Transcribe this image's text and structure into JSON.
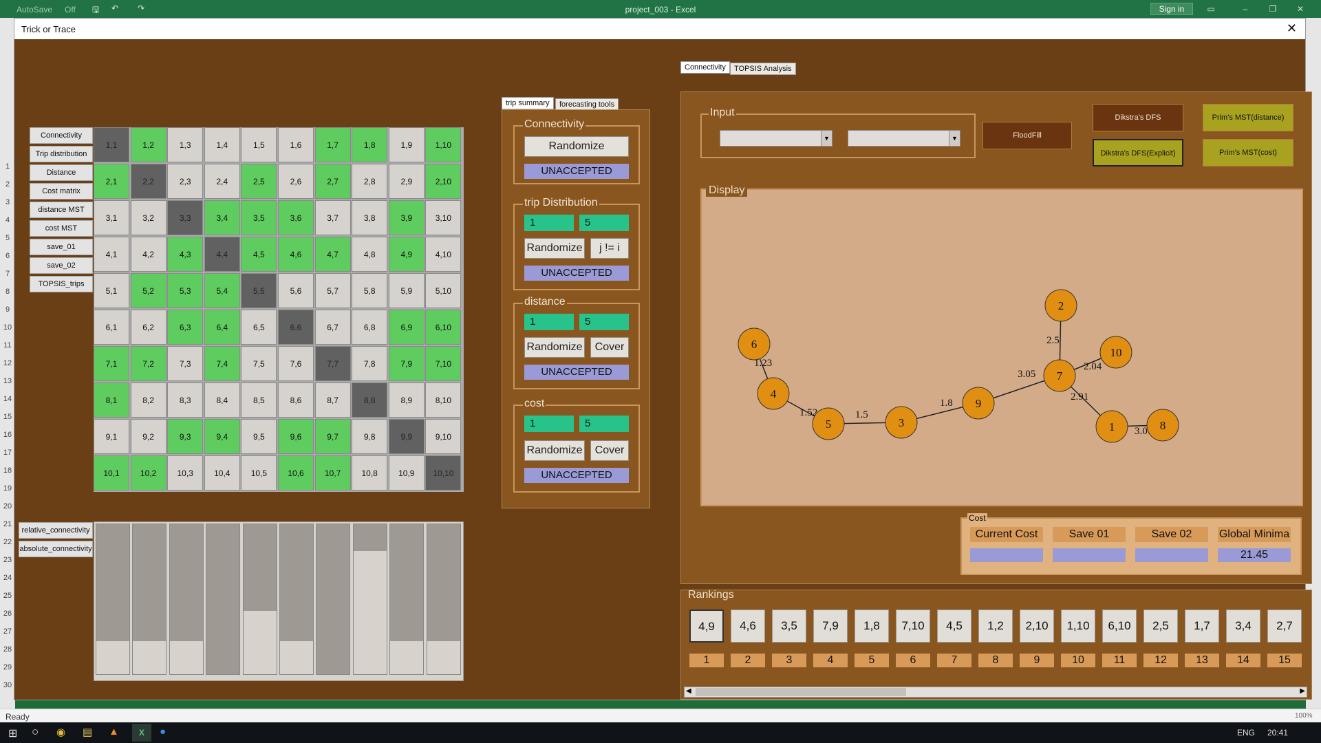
{
  "excel": {
    "autosave": "AutoSave",
    "autosave_state": "Off",
    "title": "project_003 - Excel",
    "sign_in": "Sign in",
    "status": "Ready",
    "zoom": "100%",
    "row_numbers": [
      "1",
      "2",
      "3",
      "4",
      "5",
      "6",
      "7",
      "8",
      "9",
      "10",
      "11",
      "12",
      "13",
      "14",
      "15",
      "16",
      "17",
      "18",
      "19",
      "20",
      "21",
      "22",
      "23",
      "24",
      "25",
      "26",
      "27",
      "28",
      "29",
      "30"
    ]
  },
  "taskbar": {
    "lang": "ENG",
    "time": "20:41"
  },
  "form": {
    "title": "Trick or Trace",
    "close_label": "✕",
    "left_buttons": [
      "Connectivity",
      "Trip distribution",
      "Distance",
      "Cost matrix",
      "distance MST",
      "cost MST",
      "save_01",
      "save_02",
      "TOPSIS_trips"
    ],
    "bar_buttons": [
      "relative_connectivity",
      "absolute_connectivity"
    ],
    "grid": [
      [
        "1,1",
        "1,2",
        "1,3",
        "1,4",
        "1,5",
        "1,6",
        "1,7",
        "1,8",
        "1,9",
        "1,10"
      ],
      [
        "2,1",
        "2,2",
        "2,3",
        "2,4",
        "2,5",
        "2,6",
        "2,7",
        "2,8",
        "2,9",
        "2,10"
      ],
      [
        "3,1",
        "3,2",
        "3,3",
        "3,4",
        "3,5",
        "3,6",
        "3,7",
        "3,8",
        "3,9",
        "3,10"
      ],
      [
        "4,1",
        "4,2",
        "4,3",
        "4,4",
        "4,5",
        "4,6",
        "4,7",
        "4,8",
        "4,9",
        "4,10"
      ],
      [
        "5,1",
        "5,2",
        "5,3",
        "5,4",
        "5,5",
        "5,6",
        "5,7",
        "5,8",
        "5,9",
        "5,10"
      ],
      [
        "6,1",
        "6,2",
        "6,3",
        "6,4",
        "6,5",
        "6,6",
        "6,7",
        "6,8",
        "6,9",
        "6,10"
      ],
      [
        "7,1",
        "7,2",
        "7,3",
        "7,4",
        "7,5",
        "7,6",
        "7,7",
        "7,8",
        "7,9",
        "7,10"
      ],
      [
        "8,1",
        "8,2",
        "8,3",
        "8,4",
        "8,5",
        "8,6",
        "8,7",
        "8,8",
        "8,9",
        "8,10"
      ],
      [
        "9,1",
        "9,2",
        "9,3",
        "9,4",
        "9,5",
        "9,6",
        "9,7",
        "9,8",
        "9,9",
        "9,10"
      ],
      [
        "10,1",
        "10,2",
        "10,3",
        "10,4",
        "10,5",
        "10,6",
        "10,7",
        "10,8",
        "10,9",
        "10,10"
      ]
    ],
    "grid_state": [
      [
        "d",
        "g",
        "n",
        "n",
        "n",
        "n",
        "g",
        "g",
        "n",
        "g"
      ],
      [
        "g",
        "d",
        "n",
        "n",
        "g",
        "n",
        "g",
        "n",
        "n",
        "g"
      ],
      [
        "n",
        "n",
        "d",
        "g",
        "g",
        "g",
        "n",
        "n",
        "g",
        "n"
      ],
      [
        "n",
        "n",
        "g",
        "d",
        "g",
        "g",
        "g",
        "n",
        "g",
        "n"
      ],
      [
        "n",
        "g",
        "g",
        "g",
        "d",
        "n",
        "n",
        "n",
        "n",
        "n"
      ],
      [
        "n",
        "n",
        "g",
        "g",
        "n",
        "d",
        "n",
        "n",
        "g",
        "g"
      ],
      [
        "g",
        "g",
        "n",
        "g",
        "n",
        "n",
        "d",
        "n",
        "g",
        "g"
      ],
      [
        "g",
        "n",
        "n",
        "n",
        "n",
        "n",
        "n",
        "d",
        "n",
        "n"
      ],
      [
        "n",
        "n",
        "g",
        "g",
        "n",
        "g",
        "g",
        "n",
        "d",
        "n"
      ],
      [
        "g",
        "g",
        "n",
        "n",
        "n",
        "g",
        "g",
        "n",
        "n",
        "d"
      ]
    ],
    "bar_levels": [
      0.78,
      0.78,
      0.78,
      1.0,
      0.58,
      0.78,
      1.0,
      0.18,
      0.78,
      0.78
    ],
    "summary_tabs": [
      "trip summary",
      "forecasting tools"
    ],
    "connectivity": {
      "title": "Connectivity",
      "randomize": "Randomize",
      "status": "UNACCEPTED"
    },
    "trip": {
      "title": "trip Distribution",
      "from": "1",
      "to": "5",
      "randomize": "Randomize",
      "extra": "j != i",
      "status": "UNACCEPTED"
    },
    "distance": {
      "title": "distance",
      "from": "1",
      "to": "5",
      "randomize": "Randomize",
      "extra": "Cover",
      "status": "UNACCEPTED"
    },
    "cost": {
      "title": "cost",
      "from": "1",
      "to": "5",
      "randomize": "Randomize",
      "extra": "Cover",
      "status": "UNACCEPTED"
    },
    "right_tabs": [
      "Connectivity",
      "TOPSIS Analysis"
    ],
    "input_title": "Input",
    "combo1": "",
    "combo2": "",
    "algo_buttons": {
      "floodfill": "FloodFill",
      "dikstra_dfs": "Dikstra's DFS",
      "dikstra_explicit": "Dikstra's DFS(Explicit)",
      "prim_distance": "Prim's MST(distance)",
      "prim_cost": "Prim's MST(cost)"
    },
    "colors": {
      "floodfill": "#6a3410",
      "dikstra_dfs": "#6a3410",
      "olive": "#a8a220",
      "node": "#e08f12",
      "form_bg": "#6b3f16"
    },
    "display_title": "Display",
    "graph": {
      "nodes": [
        "6",
        "4",
        "5",
        "3",
        "9",
        "7",
        "2",
        "10",
        "1",
        "8"
      ],
      "edges": [
        {
          "from": "6",
          "to": "4",
          "label": "1.23"
        },
        {
          "from": "4",
          "to": "5",
          "label": "1.52"
        },
        {
          "from": "5",
          "to": "3",
          "label": "1.5"
        },
        {
          "from": "3",
          "to": "9",
          "label": "1.8"
        },
        {
          "from": "9",
          "to": "7",
          "label": "3.05"
        },
        {
          "from": "7",
          "to": "2",
          "label": "2.5"
        },
        {
          "from": "7",
          "to": "10",
          "label": "2.04"
        },
        {
          "from": "7",
          "to": "1",
          "label": "2.91"
        },
        {
          "from": "1",
          "to": "8",
          "label": "3.01"
        }
      ]
    },
    "cost_panel": {
      "title": "Cost",
      "labels": [
        "Current Cost",
        "Save 01",
        "Save 02",
        "Global Minima"
      ],
      "values": [
        "",
        "",
        "",
        "21.45"
      ]
    },
    "rankings": {
      "title": "Rankings",
      "items": [
        "4,9",
        "4,6",
        "3,5",
        "7,9",
        "1,8",
        "7,10",
        "4,5",
        "1,2",
        "2,10",
        "1,10",
        "6,10",
        "2,5",
        "1,7",
        "3,4",
        "2,7"
      ],
      "ranks": [
        "1",
        "2",
        "3",
        "4",
        "5",
        "6",
        "7",
        "8",
        "9",
        "10",
        "11",
        "12",
        "13",
        "14",
        "15"
      ]
    }
  }
}
